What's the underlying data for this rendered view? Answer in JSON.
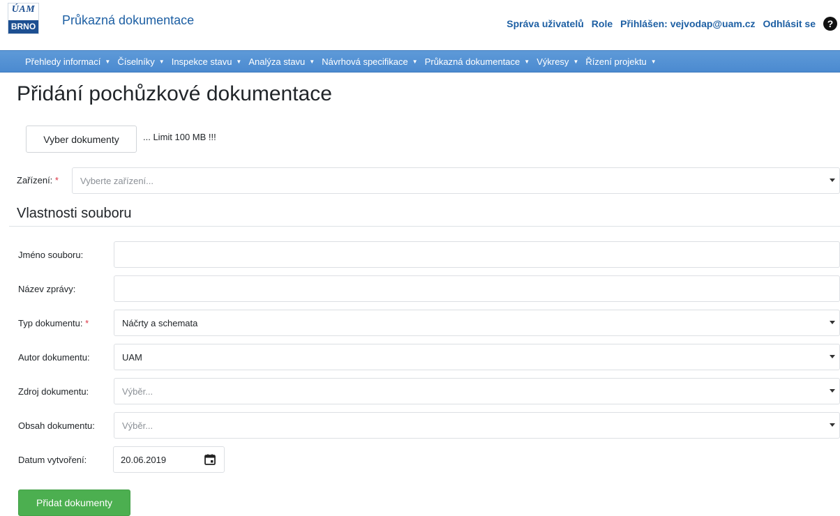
{
  "header": {
    "logo_top": "ÚAM",
    "logo_bottom": "BRNO",
    "app_title": "Průkazná dokumentace",
    "links": {
      "user_admin": "Správa uživatelů",
      "role": "Role",
      "logged_in": "Přihlášen: vejvodap@uam.cz",
      "logout": "Odhlásit se"
    },
    "help_icon": "question-circle-icon"
  },
  "nav": {
    "items": [
      "Přehledy informací",
      "Číselníky",
      "Inspekce stavu",
      "Analýza stavu",
      "Návrhová specifikace",
      "Průkazná dokumentace",
      "Výkresy",
      "Řízení projektu"
    ]
  },
  "page": {
    "title": "Přidání pochůzkové dokumentace",
    "select_docs_button": "Vyber dokumenty",
    "limit_note": "... Limit 100 MB !!!",
    "device": {
      "label": "Zařízení:",
      "required_mark": "*",
      "placeholder": "Vyberte zařízení..."
    },
    "section_title": "Vlastnosti souboru",
    "fields": {
      "file_name": {
        "label": "Jméno souboru:",
        "value": ""
      },
      "report_name": {
        "label": "Název zprávy:",
        "value": ""
      },
      "doc_type": {
        "label": "Typ dokumentu:",
        "required_mark": "*",
        "value": "Náčrty a schemata"
      },
      "doc_author": {
        "label": "Autor dokumentu:",
        "value": "UAM"
      },
      "doc_source": {
        "label": "Zdroj dokumentu:",
        "placeholder": "Výběr..."
      },
      "doc_content": {
        "label": "Obsah dokumentu:",
        "placeholder": "Výběr..."
      },
      "created_date": {
        "label": "Datum vytvoření:",
        "value": "20.06.2019"
      }
    },
    "submit_button": "Přidat dokumenty"
  },
  "colors": {
    "brand_blue": "#1d5fa3",
    "nav_blue": "#5b98d6",
    "success_green": "#4caf50",
    "required_red": "#dc3545"
  }
}
